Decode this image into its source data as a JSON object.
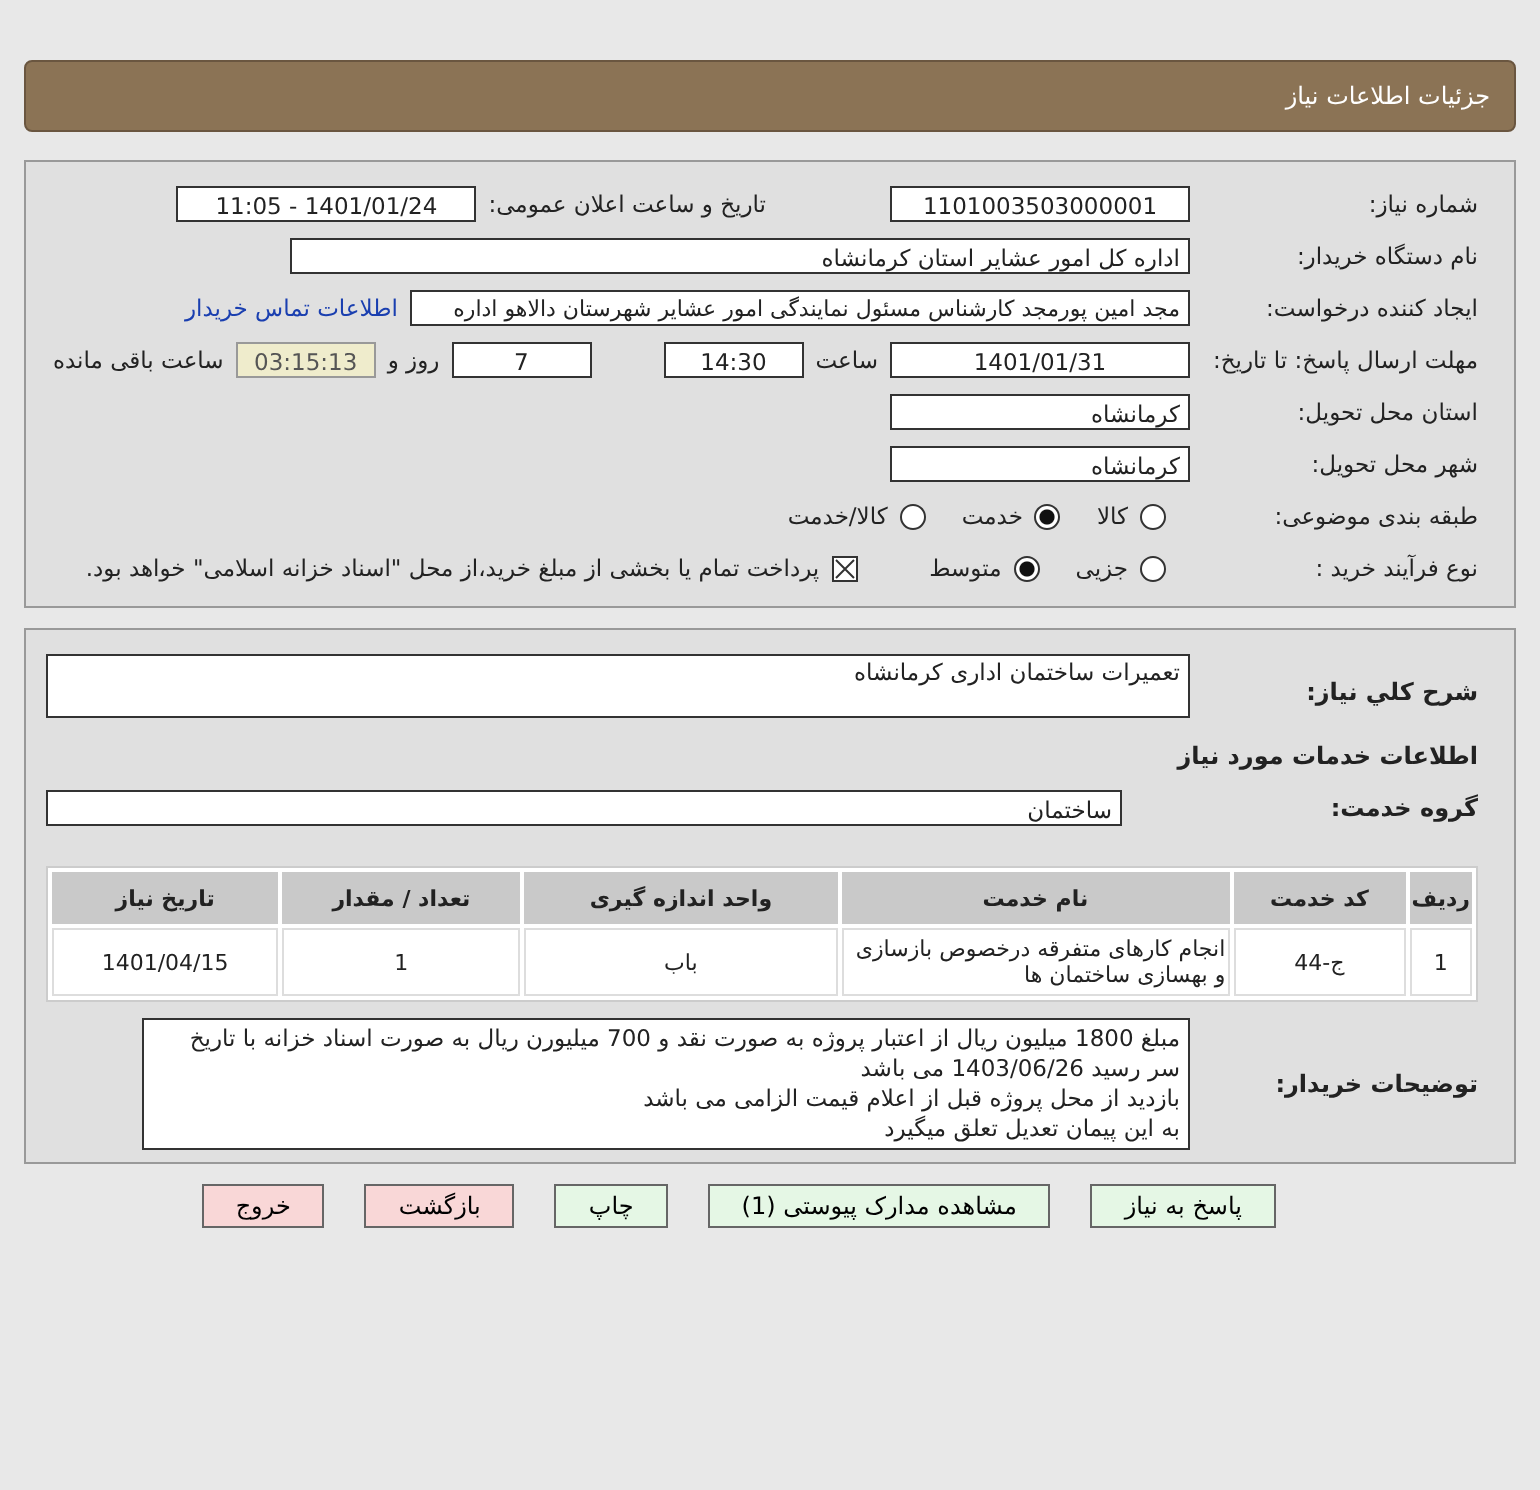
{
  "header": {
    "title": "جزئیات اطلاعات نیاز"
  },
  "need_number": {
    "label": "شماره نیاز:",
    "value": "1101003503000001"
  },
  "announce": {
    "label": "تاریخ و ساعت اعلان عمومی:",
    "value": "1401/01/24 - 11:05"
  },
  "buyer_org": {
    "label": "نام دستگاه خریدار:",
    "value": "اداره کل امور عشایر استان کرمانشاه"
  },
  "requester": {
    "label": "ایجاد کننده درخواست:",
    "value": "مجد امین پورمجد کارشناس مسئول نمایندگی امور عشایر شهرستان دالاهو اداره",
    "link": "اطلاعات تماس خریدار"
  },
  "deadline": {
    "label": "مهلت ارسال پاسخ: تا تاریخ:",
    "date": "1401/01/31",
    "time_label": "ساعت",
    "time": "14:30",
    "days": "7",
    "days_label": "روز و",
    "remaining": "03:15:13",
    "remaining_label": "ساعت باقی مانده"
  },
  "province": {
    "label": "استان محل تحویل:",
    "value": "کرمانشاه"
  },
  "city": {
    "label": "شهر محل تحویل:",
    "value": "کرمانشاه"
  },
  "category": {
    "label": "طبقه بندی موضوعی:",
    "options": [
      {
        "label": "کالا",
        "selected": false
      },
      {
        "label": "خدمت",
        "selected": true
      },
      {
        "label": "کالا/خدمت",
        "selected": false
      }
    ]
  },
  "purchase_type": {
    "label": "نوع فرآیند خرید :",
    "options": [
      {
        "label": "جزیی",
        "selected": false
      },
      {
        "label": "متوسط",
        "selected": true
      }
    ],
    "payment": {
      "checked": true,
      "text": "پرداخت تمام یا بخشی از مبلغ خرید،از محل \"اسناد خزانه اسلامی\" خواهد بود."
    }
  },
  "summary": {
    "label": "شرح کلي نیاز:",
    "value": "تعمیرات ساختمان اداری کرمانشاه"
  },
  "services_heading": "اطلاعات خدمات مورد نیاز",
  "service_group": {
    "label": "گروه خدمت:",
    "value": "ساختمان"
  },
  "table": {
    "columns": [
      "ردیف",
      "کد خدمت",
      "نام خدمت",
      "واحد اندازه گیری",
      "تعداد / مقدار",
      "تاریخ نیاز"
    ],
    "rows": [
      [
        "1",
        "ج-44",
        "انجام کارهای متفرقه درخصوص بازسازی و بهسازی ساختمان ها",
        "باب",
        "1",
        "1401/04/15"
      ]
    ]
  },
  "notes": {
    "label": "توضیحات خریدار:",
    "lines": [
      "مبلغ 1800 میلیون ریال از اعتبار پروژه به صورت نقد و 700 میلیورن ریال به صورت اسناد خزانه با تاریخ سر رسید 1403/06/26 می باشد",
      "بازدید از محل پروژه قبل از اعلام قیمت الزامی می باشد",
      "به این پیمان تعدیل تعلق میگیرد"
    ]
  },
  "buttons": [
    {
      "label": "پاسخ به نیاز",
      "kind": "normal"
    },
    {
      "label": "مشاهده مدارک پیوستی (1)",
      "kind": "normal"
    },
    {
      "label": "چاپ",
      "kind": "normal"
    },
    {
      "label": "بازگشت",
      "kind": "danger"
    },
    {
      "label": "خروج",
      "kind": "danger"
    }
  ]
}
